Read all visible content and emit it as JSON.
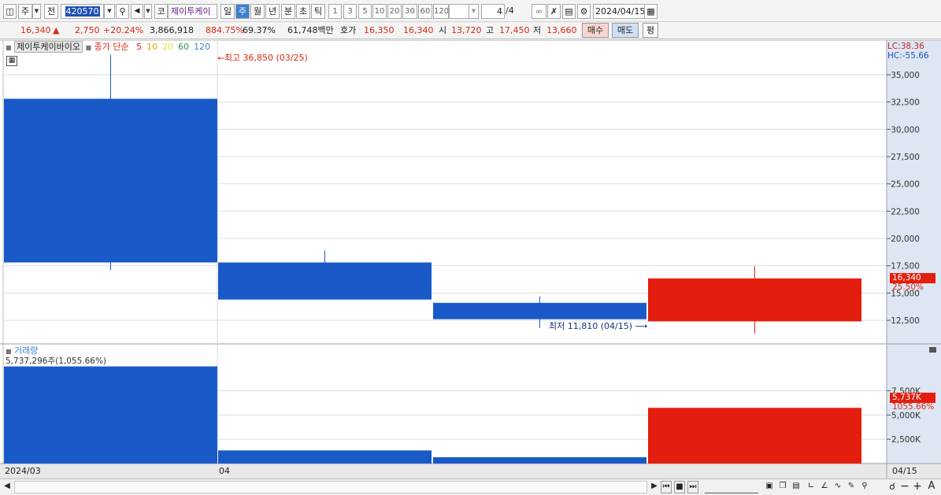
{
  "toolbar": {
    "market_label": "주",
    "prev_label": "전",
    "stock_code": "420570",
    "stock_name_prefix": "코",
    "stock_name": "제이투케이",
    "periods": [
      "일",
      "주",
      "월",
      "년",
      "분",
      "초",
      "틱"
    ],
    "selected_period": "주",
    "intervals": [
      "1",
      "3",
      "5",
      "10",
      "20",
      "30",
      "60",
      "120"
    ],
    "page_current": "4",
    "page_total": "/4",
    "date": "2024/04/15",
    "icons": [
      "chart-window-icon",
      "search-icon",
      "speaker-icon",
      "link-icon",
      "tools-icon",
      "save-icon",
      "settings-icon",
      "calendar-icon"
    ]
  },
  "quote": {
    "price": "16,340",
    "direction_symbol": "▲",
    "change": "2,750",
    "change_pct": "+20.24%",
    "volume": "3,866,918",
    "volume_ratio": "884.75%",
    "turnover_pct": "69.37%",
    "trade_value": "61,748백만",
    "bid_label": "호가",
    "bid1": "16,350",
    "bid2": "16,340",
    "open_label": "시",
    "open": "13,720",
    "high_label": "고",
    "high": "17,450",
    "low_label": "저",
    "low": "13,660",
    "buy_label": "매수",
    "sell_label": "매도",
    "eval_label": "평"
  },
  "price_panel": {
    "title": "제이투케이바이오",
    "ma_label": "종가 단순",
    "ma_periods": [
      {
        "label": "5",
        "color": "#d42b10"
      },
      {
        "label": "10",
        "color": "#e3a200"
      },
      {
        "label": "20",
        "color": "#e8dc3a"
      },
      {
        "label": "60",
        "color": "#2f8f5a"
      },
      {
        "label": "120",
        "color": "#3c7fd5"
      }
    ],
    "high_note": "최고 36,850 (03/25)",
    "low_note": "최저 11,810 (04/15)",
    "lc_text": "LC:38.36",
    "hc_text": "HC:-55.66",
    "current_price_tag": "16,340",
    "current_pct_tag": "25.50%"
  },
  "volume_panel": {
    "title": "거래량",
    "value_text": "5,737,296주(1,055.66%)",
    "current_tag": "5,737K",
    "current_pct_tag": "1055.66%"
  },
  "x_axis": {
    "labels": [
      "2024/03",
      "04",
      "04/15"
    ]
  },
  "chart_data": {
    "type": "candlestick",
    "price_axis": {
      "ticks": [
        12500,
        15000,
        17500,
        20000,
        22500,
        25000,
        27500,
        30000,
        32500,
        35000
      ],
      "tick_labels": [
        "12,500",
        "15,000",
        "17,500",
        "20,000",
        "22,500",
        "25,000",
        "27,500",
        "30,000",
        "32,500",
        "35,000"
      ]
    },
    "volume_axis": {
      "ticks": [
        2500,
        5000,
        7500
      ],
      "tick_labels": [
        "2,500K",
        "5,000K",
        "7,500K"
      ]
    },
    "candles": [
      {
        "open": 32800,
        "close": 17800,
        "high": 36850,
        "low": 17100,
        "volume": 10000,
        "color": "#1a5ac8"
      },
      {
        "open": 17800,
        "close": 14400,
        "high": 18900,
        "low": 14400,
        "volume": 1350,
        "color": "#1a5ac8"
      },
      {
        "open": 14100,
        "close": 12600,
        "high": 14700,
        "low": 11810,
        "volume": 650,
        "color": "#1a5ac8"
      },
      {
        "open": 12400,
        "close": 16340,
        "high": 17450,
        "low": 11300,
        "volume": 5737,
        "color": "#e41e0e"
      }
    ]
  },
  "colors": {
    "up": "#e41e0e",
    "down": "#1a5ac8",
    "axis_bg": "#dde6f2",
    "grid": "#d9dee6"
  },
  "bottom_nav": {
    "zoom_minus": "−",
    "zoom_plus": "+",
    "font_label": "A"
  }
}
